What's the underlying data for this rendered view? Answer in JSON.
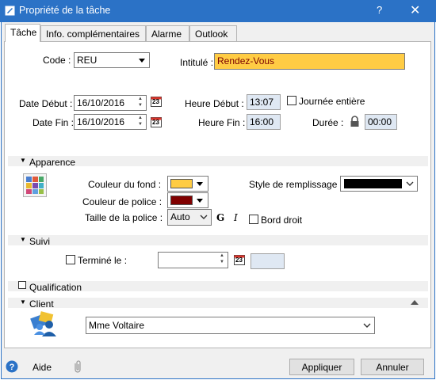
{
  "window": {
    "title": "Propriété de la tâche",
    "help_glyph": "?",
    "close_glyph": "✕"
  },
  "tabs": [
    {
      "label": "Tâche"
    },
    {
      "label": "Info. complémentaires"
    },
    {
      "label": "Alarme"
    },
    {
      "label": "Outlook"
    }
  ],
  "task": {
    "code_label": "Code :",
    "code_value": "REU",
    "intitule_label": "Intitulé :",
    "intitule_value": "Rendez-Vous",
    "date_debut_label": "Date Début :",
    "date_debut_value": "16/10/2016",
    "date_fin_label": "Date Fin :",
    "date_fin_value": "16/10/2016",
    "heure_debut_label": "Heure Début :",
    "heure_debut_value": "13:07",
    "heure_fin_label": "Heure Fin :",
    "heure_fin_value": "16:00",
    "journee_label": "Journée entière",
    "duree_label": "Durée :",
    "duree_value": "00:00",
    "calendar_day": "23"
  },
  "apparence": {
    "section_label": "Apparence",
    "couleur_fond_label": "Couleur du fond :",
    "couleur_fond": "#ffcc44",
    "couleur_police_label": "Couleur de police :",
    "couleur_police": "#800000",
    "taille_police_label": "Taille de la police :",
    "taille_police_value": "Auto",
    "bold_glyph": "G",
    "italic_glyph": "I",
    "bord_droit_label": "Bord droit",
    "style_remplissage_label": "Style de remplissage :",
    "style_remplissage_color": "#000000"
  },
  "suivi": {
    "section_label": "Suivi",
    "termine_label": "Terminé le :",
    "termine_value": ""
  },
  "qualification": {
    "section_label": "Qualification"
  },
  "client": {
    "section_label": "Client",
    "value": "Mme Voltaire"
  },
  "footer": {
    "aide_label": "Aide",
    "appliquer_label": "Appliquer",
    "annuler_label": "Annuler"
  },
  "colors": {
    "titlebar": "#2b72c6",
    "intitule_bg": "#ffcc44"
  }
}
